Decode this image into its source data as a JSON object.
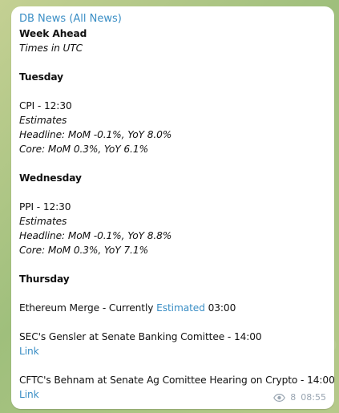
{
  "channel": {
    "name": "DB News (All News)"
  },
  "header": {
    "title": "Week Ahead",
    "subtitle": "Times in UTC"
  },
  "sections": {
    "tuesday": {
      "day": "Tuesday",
      "event": "CPI - 12:30",
      "estimates_label": "Estimates",
      "headline": "Headline: MoM -0.1%, YoY 8.0%",
      "core": "Core: MoM 0.3%, YoY 6.1%"
    },
    "wednesday": {
      "day": "Wednesday",
      "event": "PPI - 12:30",
      "estimates_label": "Estimates",
      "headline": "Headline: MoM -0.1%, YoY 8.8%",
      "core": "Core: MoM 0.3%, YoY 7.1%"
    },
    "thursday": {
      "day": "Thursday",
      "merge_prefix": "Ethereum Merge - Currently ",
      "merge_link": "Estimated",
      "merge_suffix": " 03:00",
      "sec_event": "SEC's Gensler at Senate Banking Comittee - 14:00",
      "sec_link": "Link",
      "cftc_event": "CFTC's Behnam at Senate Ag Comittee Hearing on Crypto - 14:00",
      "cftc_link": "Link"
    }
  },
  "footer": {
    "views_icon": "eye-icon",
    "views": "8",
    "time": "08:55"
  },
  "colors": {
    "link": "#3a8ec5",
    "background": "#b7c788",
    "bubble": "#ffffff",
    "meta": "#9aa6b2"
  }
}
